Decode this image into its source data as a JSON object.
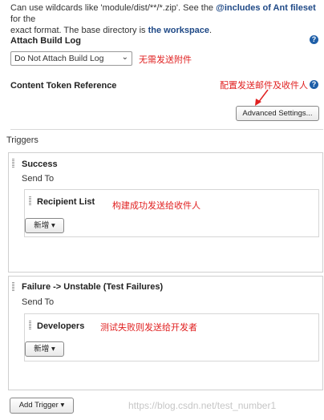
{
  "top_help": {
    "text1": "Can use wildcards like 'module/dist/**/*.zip'. See the",
    "fileset_link": "@includes of Ant fileset",
    "text2": "for the",
    "text3": "exact format. The base directory is",
    "workspace_link": "the workspace",
    "text4": "."
  },
  "attach_build_log": {
    "label": "Attach Build Log",
    "selected": "Do Not Attach Build Log",
    "annotation": "无需发送附件"
  },
  "content_token": {
    "label": "Content Token Reference",
    "annotation": "配置发送邮件及收件人"
  },
  "advanced_button": "Advanced Settings...",
  "triggers": {
    "label": "Triggers",
    "items": [
      {
        "title": "Success",
        "send_to": "Send To",
        "recipient": "Recipient List",
        "annotation": "构建成功发送给收件人",
        "add_button": "新增"
      },
      {
        "title": "Failure -> Unstable (Test Failures)",
        "send_to": "Send To",
        "recipient": "Developers",
        "annotation": "测试失败则发送给开发者",
        "add_button": "新增"
      }
    ],
    "add_trigger": "Add Trigger"
  },
  "watermark": "https://blog.csdn.net/test_number1",
  "colors": {
    "link": "#204a87",
    "annotation": "#e02020",
    "help_icon": "#1f5fa8"
  }
}
